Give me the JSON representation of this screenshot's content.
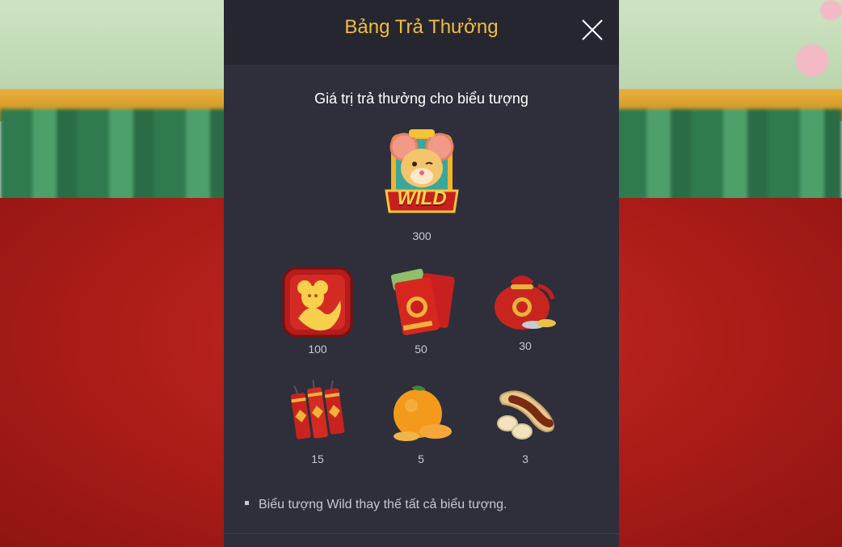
{
  "modal": {
    "title": "Bảng Trả Thưởng",
    "section_title": "Giá trị trả thưởng cho biểu tượng",
    "wild": {
      "icon": "wild-mouse-icon",
      "label": "WILD",
      "value": "300"
    },
    "symbols_row1": [
      {
        "icon": "gold-mouse-emblem-icon",
        "value": "100"
      },
      {
        "icon": "red-envelope-money-icon",
        "value": "50"
      },
      {
        "icon": "red-pouch-coins-icon",
        "value": "30"
      }
    ],
    "symbols_row2": [
      {
        "icon": "firecrackers-icon",
        "value": "15"
      },
      {
        "icon": "mandarin-orange-icon",
        "value": "5"
      },
      {
        "icon": "peanuts-icon",
        "value": "3"
      }
    ],
    "note": "Biểu tượng Wild thay thế tất cả biểu tượng."
  },
  "colors": {
    "title": "#f1bd3c",
    "panel": "#2e2f3b",
    "header": "#25262f"
  }
}
